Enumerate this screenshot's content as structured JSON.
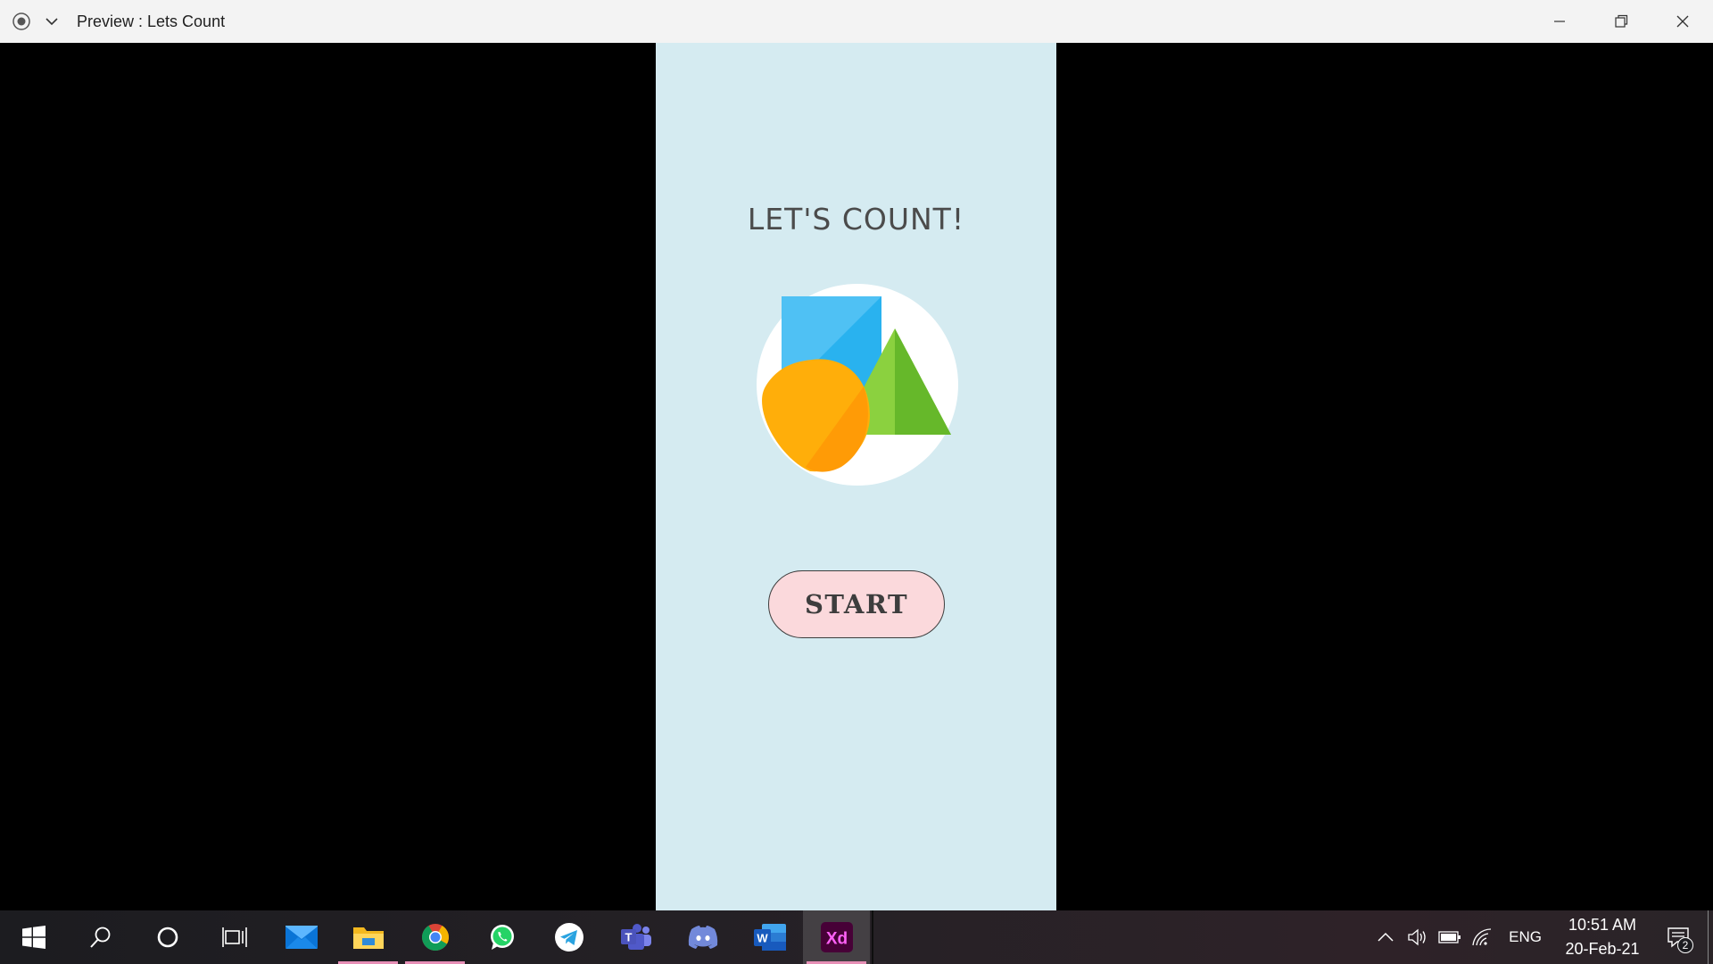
{
  "window": {
    "title": "Preview : Lets Count"
  },
  "app": {
    "title": "LET'S COUNT!",
    "start_label": "START",
    "background_color": "#d5ebf1",
    "button_color": "#fbd9dc"
  },
  "taskbar": {
    "apps": [
      {
        "name": "start",
        "icon": "windows-logo-icon"
      },
      {
        "name": "search",
        "icon": "search-icon"
      },
      {
        "name": "cortana",
        "icon": "cortana-icon"
      },
      {
        "name": "task-view",
        "icon": "task-view-icon"
      },
      {
        "name": "mail",
        "icon": "mail-icon"
      },
      {
        "name": "file-explorer",
        "icon": "folder-icon",
        "running": true
      },
      {
        "name": "chrome",
        "icon": "chrome-icon",
        "running": true
      },
      {
        "name": "whatsapp",
        "icon": "whatsapp-icon"
      },
      {
        "name": "telegram",
        "icon": "telegram-icon"
      },
      {
        "name": "teams",
        "icon": "teams-icon"
      },
      {
        "name": "discord",
        "icon": "discord-icon"
      },
      {
        "name": "word",
        "icon": "word-icon"
      },
      {
        "name": "adobe-xd",
        "icon": "adobe-xd-icon",
        "running": true,
        "active": true
      }
    ],
    "tray": {
      "language": "ENG",
      "time": "10:51 AM",
      "date": "20-Feb-21",
      "notification_count": "2"
    },
    "labels": {
      "word": "W",
      "xd": "Xd"
    }
  }
}
